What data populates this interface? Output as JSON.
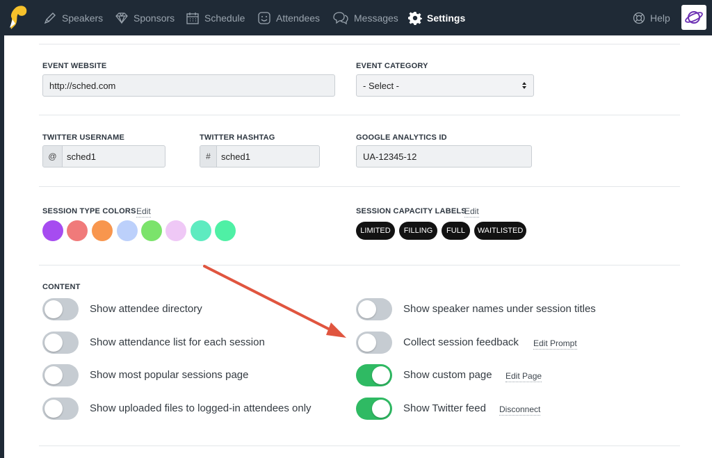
{
  "nav": {
    "items": [
      {
        "label": "Speakers",
        "icon": "pen-icon"
      },
      {
        "label": "Sponsors",
        "icon": "diamond-icon"
      },
      {
        "label": "Schedule",
        "icon": "calendar-icon"
      },
      {
        "label": "Attendees",
        "icon": "smiley-icon"
      },
      {
        "label": "Messages",
        "icon": "chat-bubbles-icon"
      },
      {
        "label": "Settings",
        "icon": "gear-icon",
        "active": true
      }
    ],
    "help": "Help"
  },
  "website": {
    "label": "EVENT WEBSITE",
    "value": "http://sched.com"
  },
  "category": {
    "label": "EVENT CATEGORY",
    "value": "- Select -"
  },
  "twitter_user": {
    "label": "TWITTER USERNAME",
    "prefix": "@",
    "value": "sched1"
  },
  "twitter_tag": {
    "label": "TWITTER HASHTAG",
    "prefix": "#",
    "value": "sched1"
  },
  "analytics": {
    "label": "GOOGLE ANALYTICS ID",
    "value": "UA-12345-12"
  },
  "colors": {
    "label": "SESSION TYPE COLORS",
    "edit": "Edit",
    "swatches": [
      "#a64cf0",
      "#f07a7a",
      "#f8964e",
      "#bcd0fb",
      "#7be36b",
      "#efc8f6",
      "#5eebc0",
      "#4ff0a5"
    ]
  },
  "capacity": {
    "label": "SESSION CAPACITY LABELS",
    "edit": "Edit",
    "pills": [
      "LIMITED",
      "FILLING",
      "FULL",
      "WAITLISTED"
    ]
  },
  "content": {
    "label": "CONTENT",
    "left": [
      {
        "label": "Show attendee directory",
        "on": false
      },
      {
        "label": "Show attendance list for each session",
        "on": false
      },
      {
        "label": "Show most popular sessions page",
        "on": false
      },
      {
        "label": "Show uploaded files to logged-in attendees only",
        "on": false
      }
    ],
    "right": [
      {
        "label": "Show speaker names under session titles",
        "on": false,
        "link": ""
      },
      {
        "label": "Collect session feedback",
        "on": false,
        "link": "Edit Prompt"
      },
      {
        "label": "Show custom page",
        "on": true,
        "link": "Edit Page"
      },
      {
        "label": "Show Twitter feed",
        "on": true,
        "link": "Disconnect"
      }
    ]
  },
  "theme": {
    "nav_bg": "#1f2a36",
    "toggle_on": "#2fba63",
    "toggle_off": "#c6ccd2",
    "arrow": "#e0553f"
  }
}
